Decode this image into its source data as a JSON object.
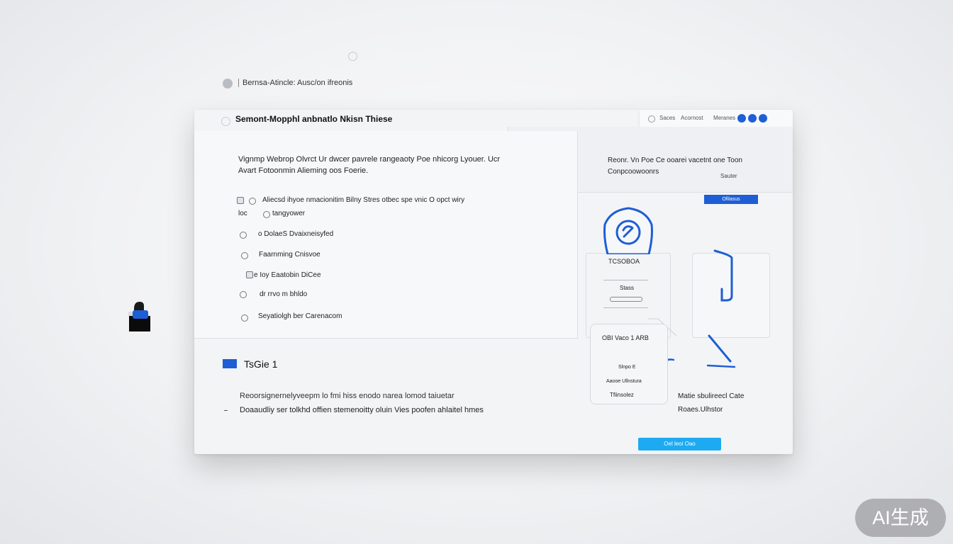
{
  "header": {
    "breadcrumb": "Bernsa-Atincle: Ausc/on ifreonis"
  },
  "window": {
    "title": "Semont-Mopphl anbnatlo Nkisn Thiese",
    "controls": {
      "label_a": "Saces",
      "label_b": "Acornost",
      "label_c": "Meranes"
    }
  },
  "intro": {
    "line1": "Vignmp Webrop Olvrct Ur dwcer pavrele rangeaoty Poe nhicorg   Lyouer. Ucr",
    "line2": "Avart Fotoonmin Alieming oos Foerie."
  },
  "list": [
    {
      "label": "Aliecsd ihyoe nmacionitim Bilny  Stres otbec spe vnic O opct wiry",
      "sub": "loc",
      "sub2": "tangyower"
    },
    {
      "label": "o DolaeS Dvaixneisyfed"
    },
    {
      "label": "Faarnming Cnisvoe"
    },
    {
      "label": "e Ioy Eaatobin DiCee"
    },
    {
      "label": "dr rrvo m bhldo"
    },
    {
      "label": "Seyatiolgh ber Carenacom"
    }
  ],
  "right_panel": {
    "text1": "Reonr. Vn Poe Ce ooarei vacetnt one Toon",
    "text2": "Conpcoowoonrs",
    "small": "Sauter",
    "button": "Ofilasus"
  },
  "mid_card": {
    "title": "TCSOBOA",
    "field": "Stass",
    "caption": "OBI Vaco 1 ARB"
  },
  "small_card": {
    "line1": "Slnpo E",
    "line2": "Aaooe Ullnstura",
    "line3": "Tfiinsolez"
  },
  "side_note": {
    "line1": "Matie sbulireecl Cate",
    "line2": "Roaes.Ulhstor"
  },
  "section": {
    "title": "TsGie 1",
    "desc1": "Reoorsignernelyveepm lo fmi hiss enodo narea lomod taiuetar",
    "desc2": "Doaaudliy ser tolkhd offien stemenoitty oluin Vies poofen ahlaitel hmes"
  },
  "cta": {
    "label": "Oel leoi Oao"
  },
  "badge": {
    "label": "AI生成"
  },
  "colors": {
    "accent": "#1e5ed4",
    "cta": "#1eaaf0"
  }
}
